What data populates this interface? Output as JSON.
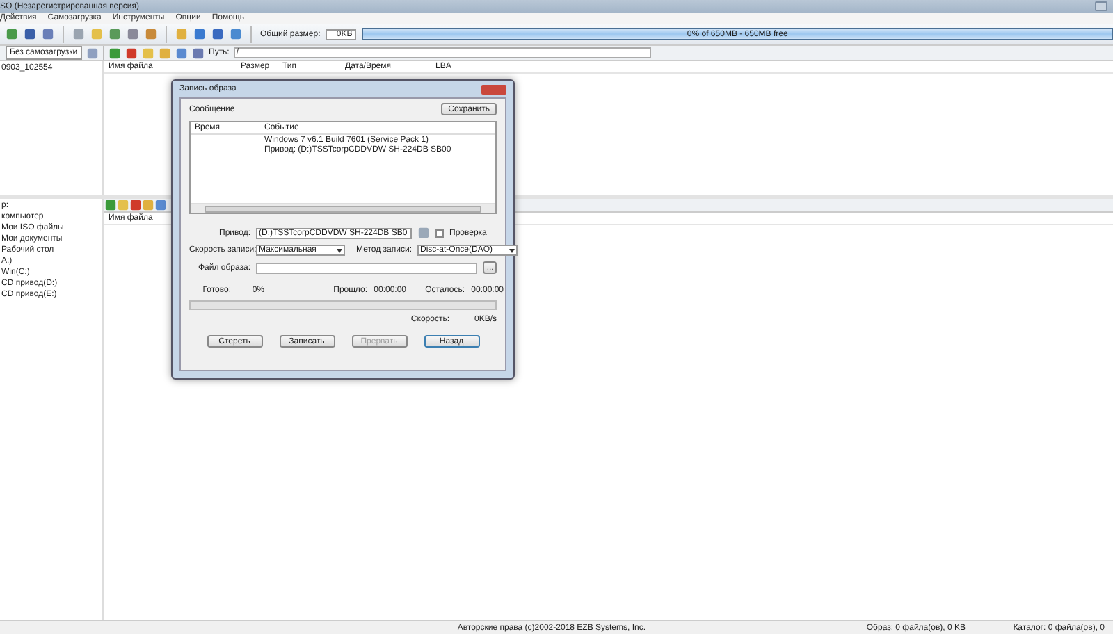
{
  "window": {
    "title": "SO (Незарегистрированная версия)"
  },
  "menu": [
    "Действия",
    "Самозагрузка",
    "Инструменты",
    "Опции",
    "Помощь"
  ],
  "toolbar": {
    "size_label": "Общий размер:",
    "size_value": "0KB",
    "capacity": "0% of 650MB - 650MB free"
  },
  "image_panel": {
    "boot": "Без самозагрузки",
    "path_label": "Путь:",
    "path": "/",
    "tree": [
      "0903_102554"
    ],
    "columns": [
      "Имя файла",
      "Размер",
      "Тип",
      "Дата/Время",
      "LBA"
    ]
  },
  "local_panel": {
    "header": "р:",
    "tree": [
      "компьютер",
      "Мои ISO файлы",
      "Мои документы",
      "Рабочий стол",
      "A:)",
      "Win(C:)",
      "CD привод(D:)",
      "CD привод(E:)"
    ],
    "columns": [
      "Имя файла"
    ]
  },
  "dialog": {
    "title": "Запись образа",
    "messages_label": "Сообщение",
    "save": "Сохранить",
    "log_columns": [
      "Время",
      "Событие"
    ],
    "log": [
      {
        "event": "Windows 7 v6.1 Build 7601 (Service Pack 1)"
      },
      {
        "event": "Привод: (D:)TSSTcorpCDDVDW SH-224DB SB00"
      }
    ],
    "drive_label": "Привод:",
    "drive": "(D:)TSSTcorpCDDVDW SH-224DB SB0",
    "verify": {
      "label": "Проверка",
      "checked": false
    },
    "speed_label": "Скорость записи:",
    "speed": "Максимальная",
    "method_label": "Метод записи:",
    "method": "Disc-at-Once(DAO)",
    "file_label": "Файл образа:",
    "browse": "...",
    "done_label": "Готово:",
    "done": "0%",
    "elapsed_label": "Прошло:",
    "elapsed": "00:00:00",
    "left_label": "Осталось:",
    "left": "00:00:00",
    "progress": {
      "level": 0
    },
    "rate_label": "Скорость:",
    "rate": "0KB/s",
    "buttons": [
      {
        "label": "Стереть",
        "disabled": false,
        "default": false
      },
      {
        "label": "Записать",
        "disabled": false,
        "default": false
      },
      {
        "label": "Прервать",
        "disabled": true,
        "default": false
      },
      {
        "label": "Назад",
        "disabled": false,
        "default": true
      }
    ]
  },
  "status_bar": [
    "Авторские права (c)2002-2018 EZB Systems, Inc.",
    "Образ: 0 файла(ов), 0 KB",
    "Каталог: 0 файла(ов), 0"
  ]
}
